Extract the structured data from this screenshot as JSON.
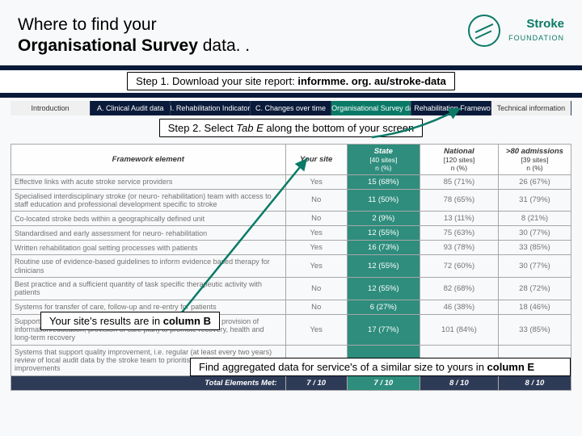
{
  "header": {
    "title_line1": "Where to find your",
    "title_line2_bold": "Organisational Survey",
    "title_line2_rest": " data. ."
  },
  "logo": {
    "line1": "Stroke",
    "line2": "FOUNDATION"
  },
  "step1": {
    "prefix": "Step 1. Download your site report: ",
    "bold": "informme. org. au/stroke-data"
  },
  "tabs": [
    "Introduction",
    "A. Clinical Audit data",
    "B. Rehabilitation Indicators",
    "C. Changes over time",
    "D. Organisational Survey data",
    "E. Rehabilitation Framework",
    "Technical information"
  ],
  "step2": {
    "prefix": "Step 2. Select ",
    "italic": "Tab E",
    "suffix": " along the bottom of your screen"
  },
  "callout_b": {
    "prefix": "Your site's results are in ",
    "bold": "column B"
  },
  "callout_e": {
    "prefix": "Find aggregated data for service's of a similar size to yours in ",
    "bold": "column E"
  },
  "table": {
    "headers": {
      "element": "Framework element",
      "your": "Your site",
      "state": {
        "label": "State",
        "sub1": "[40 sites]",
        "sub2": "n (%)"
      },
      "national": {
        "label": "National",
        "sub1": "[120 sites]",
        "sub2": "n (%)"
      },
      "big": {
        "label": ">80 admissions",
        "sub1": "[39 sites]",
        "sub2": "n (%)"
      }
    },
    "rows": [
      {
        "elem": "Effective links with acute stroke service providers",
        "your": "Yes",
        "state": "15 (68%)",
        "nat": "85 (71%)",
        "big": "26 (67%)"
      },
      {
        "elem": "Specialised interdisciplinary stroke (or neuro- rehabilitation) team with access to staff education and professional development specific to stroke",
        "your": "No",
        "state": "11 (50%)",
        "nat": "78 (65%)",
        "big": "31 (79%)"
      },
      {
        "elem": "Co-located stroke beds within a geographically defined unit",
        "your": "No",
        "state": "2 (9%)",
        "nat": "13 (11%)",
        "big": "8 (21%)"
      },
      {
        "elem": "Standardised and early assessment for neuro- rehabilitation",
        "your": "Yes",
        "state": "12 (55%)",
        "nat": "75 (63%)",
        "big": "30 (77%)"
      },
      {
        "elem": "Written rehabilitation goal setting processes with patients",
        "your": "Yes",
        "state": "16 (73%)",
        "nat": "93 (78%)",
        "big": "33 (85%)"
      },
      {
        "elem": "Routine use of evidence-based guidelines to inform evidence based therapy for clinicians",
        "your": "Yes",
        "state": "12 (55%)",
        "nat": "72 (60%)",
        "big": "30 (77%)"
      },
      {
        "elem": "Best practice and a sufficient quantity of task specific therapeutic activity with patients",
        "your": "No",
        "state": "12 (55%)",
        "nat": "82 (68%)",
        "big": "28 (72%)"
      },
      {
        "elem": "Systems for transfer of care, follow-up and re-entry for patients",
        "your": "No",
        "state": "6 (27%)",
        "nat": "46 (38%)",
        "big": "18 (46%)"
      },
      {
        "elem": "Support for the person with stroke and carer (e.g. carer training, provision of information/education, provision of care plan) to promote recovery, health and long-term recovery",
        "your": "Yes",
        "state": "17 (77%)",
        "nat": "101 (84%)",
        "big": "33 (85%)"
      },
      {
        "elem": "Systems that support quality improvement, i.e. regular (at least every two years) review of local audit data by the stroke team to prioritise and drive stroke care improvements",
        "your": "",
        "state": "",
        "nat": "",
        "big": ""
      }
    ],
    "footer": {
      "label": "Total Elements Met:",
      "your": "7 / 10",
      "state": "7 / 10",
      "nat": "8 / 10",
      "big": "8 / 10"
    }
  }
}
